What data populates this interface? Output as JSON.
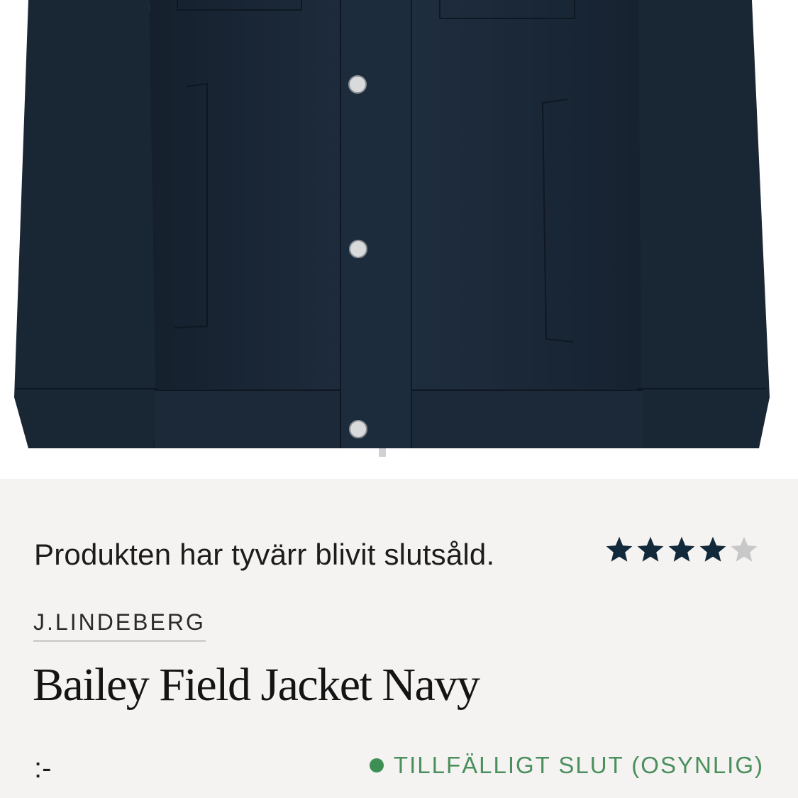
{
  "product": {
    "image_alt": "Bailey Field Jacket Navy",
    "soldout_message": "Produkten har tyvärr blivit slutsåld.",
    "rating": {
      "value": 4,
      "max": 5
    },
    "brand": "J.LINDEBERG",
    "title": "Bailey Field Jacket Navy",
    "price": ":-",
    "stock_status": "TILLFÄLLIGT SLUT (OSYNLIG)"
  },
  "colors": {
    "jacket": "#1c2b3c",
    "star_filled": "#12293b",
    "star_empty": "#c8c8c8",
    "stock_green": "#3d8f55"
  }
}
